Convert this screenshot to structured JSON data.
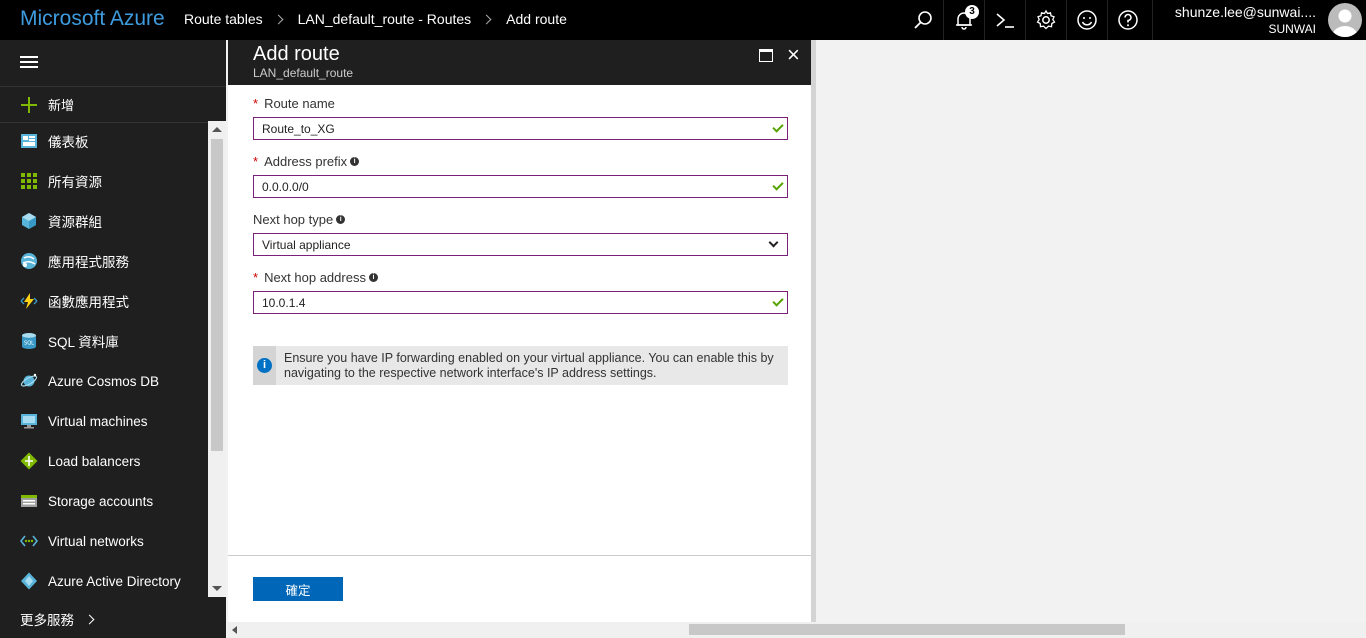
{
  "topbar": {
    "brand": "Microsoft Azure",
    "breadcrumbs": [
      "Route tables",
      "LAN_default_route - Routes",
      "Add route"
    ],
    "notification_count": "3",
    "user_email": "shunze.lee@sunwai....",
    "user_org": "SUNWAI",
    "icons": [
      "search-icon",
      "bell-icon",
      "cloud-shell-icon",
      "gear-icon",
      "smiley-icon",
      "help-icon"
    ]
  },
  "sidebar": {
    "new_label": "新增",
    "items": [
      {
        "label": "儀表板",
        "icon": "dashboard-icon"
      },
      {
        "label": "所有資源",
        "icon": "all-resources-icon"
      },
      {
        "label": "資源群組",
        "icon": "resource-groups-icon"
      },
      {
        "label": "應用程式服務",
        "icon": "app-services-icon"
      },
      {
        "label": "函數應用程式",
        "icon": "function-apps-icon"
      },
      {
        "label": "SQL 資料庫",
        "icon": "sql-database-icon"
      },
      {
        "label": "Azure Cosmos DB",
        "icon": "cosmos-db-icon"
      },
      {
        "label": "Virtual machines",
        "icon": "virtual-machines-icon"
      },
      {
        "label": "Load balancers",
        "icon": "load-balancers-icon"
      },
      {
        "label": "Storage accounts",
        "icon": "storage-accounts-icon"
      },
      {
        "label": "Virtual networks",
        "icon": "virtual-networks-icon"
      },
      {
        "label": "Azure Active Directory",
        "icon": "active-directory-icon"
      }
    ],
    "more_label": "更多服務"
  },
  "blade": {
    "title": "Add route",
    "subtitle": "LAN_default_route",
    "fields": {
      "route_name": {
        "label": "Route name",
        "value": "Route_to_XG",
        "required": true
      },
      "address_prefix": {
        "label": "Address prefix",
        "value": "0.0.0.0/0",
        "required": true
      },
      "next_hop_type": {
        "label": "Next hop type",
        "value": "Virtual appliance",
        "required": false
      },
      "next_hop_address": {
        "label": "Next hop address",
        "value": "10.0.1.4",
        "required": true
      }
    },
    "info_text": "Ensure you have IP forwarding enabled on your virtual appliance. You can enable this by navigating to the respective network interface's IP address settings.",
    "ok_label": "確定"
  },
  "colors": {
    "brand": "#3e9bde",
    "input_border": "#7a1f7a",
    "valid_check": "#57a300",
    "primary_button": "#0067b8"
  }
}
